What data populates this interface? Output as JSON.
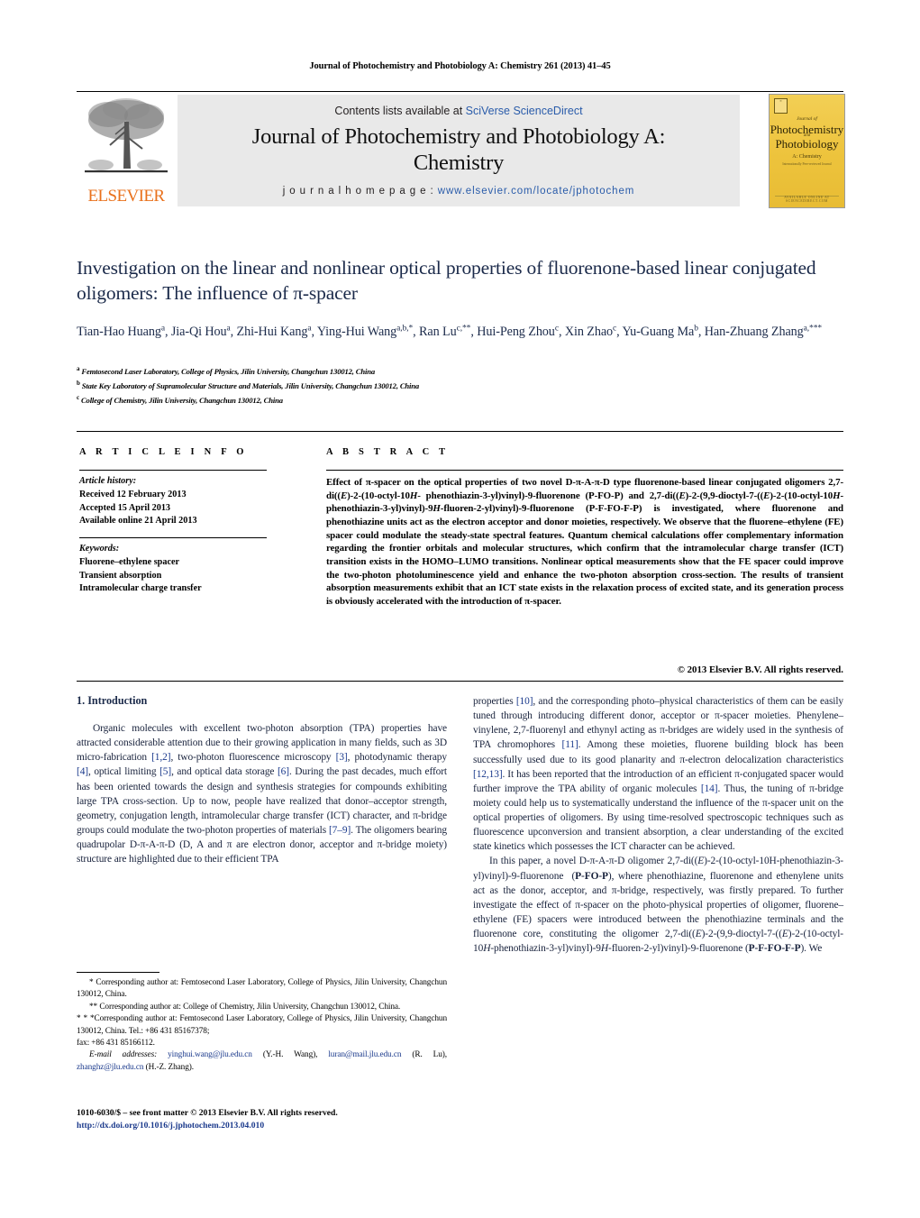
{
  "running_head": "Journal of Photochemistry and Photobiology A: Chemistry 261 (2013) 41–45",
  "masthead": {
    "contents_prefix": "Contents lists available at ",
    "contents_link": "SciVerse ScienceDirect",
    "journal_title_line1": "Journal of Photochemistry and Photobiology A:",
    "journal_title_line2": "Chemistry",
    "homepage_prefix": "j o u r n a l   h o m e p a g e :   ",
    "homepage_url": "www.elsevier.com/locate/jphotochem",
    "publisher_wordmark": "ELSEVIER",
    "cover": {
      "journal_of": "Journal of",
      "title_line1": "Photochemistry",
      "and": "and",
      "title_line2": "Photobiology",
      "subtitle": "A: Chemistry",
      "subtitle2": "Internationally Peer-reviewed Journal",
      "footer": "AVAILABLE ONLINE AT SCIENCEDIRECT.COM"
    }
  },
  "article": {
    "title": "Investigation on the linear and nonlinear optical properties of fluorenone-based linear conjugated oligomers: The influence of π-spacer",
    "authors_html": "Tian-Hao Huang<sup>a</sup>, Jia-Qi Hou<sup>a</sup>, Zhi-Hui Kang<sup>a</sup>, Ying-Hui Wang<sup>a,b,</sup><sup>*</sup>, Ran Lu<sup>c,</sup><sup>**</sup>, Hui-Peng Zhou<sup>c</sup>, Xin Zhao<sup>c</sup>, Yu-Guang Ma<sup>b</sup>, Han-Zhuang Zhang<sup>a,</sup><sup>***</sup>",
    "affiliations": [
      {
        "marker": "a",
        "text": "Femtosecond Laser Laboratory, College of Physics, Jilin University, Changchun 130012, China"
      },
      {
        "marker": "b",
        "text": "State Key Laboratory of Supramolecular Structure and Materials, Jilin University, Changchun 130012, China"
      },
      {
        "marker": "c",
        "text": "College of Chemistry, Jilin University, Changchun 130012, China"
      }
    ]
  },
  "article_info": {
    "heading": "A R T I C L E   I N F O",
    "history_label": "Article history:",
    "history": [
      "Received 12 February 2013",
      "Accepted 15 April 2013",
      "Available online 21 April 2013"
    ],
    "keywords_label": "Keywords:",
    "keywords": [
      "Fluorene–ethylene spacer",
      "Transient absorption",
      "Intramolecular charge transfer"
    ]
  },
  "abstract": {
    "heading": "A B S T R A C T",
    "text_html": "Effect of π-spacer on the optical properties of two novel D-π-A-π-D type fluorenone-based linear conjugated oligomers 2,7-di((<i>E</i>)-2-(10-octyl-10<i>H</i>- phenothiazin-3-yl)vinyl)-9-fluorenone (<b>P-FO-P</b>) and 2,7-di((<i>E</i>)-2-(9,9-dioctyl-7-((<i>E</i>)-2-(10-octyl-10<i>H</i>-phenothiazin-3-yl)vinyl)-9<i>H</i>-fluoren-2-yl)vinyl)-9-fluorenone (<b>P-F-FO-F-P</b>) is investigated, where fluorenone and phenothiazine units act as the electron acceptor and donor moieties, respectively. We observe that the fluorene–ethylene (FE) spacer could modulate the steady-state spectral features. Quantum chemical calculations offer complementary information regarding the frontier orbitals and molecular structures, which confirm that the intramolecular charge transfer (ICT) transition exists in the HOMO–LUMO transitions. Nonlinear optical measurements show that the FE spacer could improve the two-photon photoluminescence yield and enhance the two-photon absorption cross-section. The results of transient absorption measurements exhibit that an ICT state exists in the relaxation process of excited state, and its generation process is obviously accelerated with the introduction of π-spacer.",
    "copyright": "© 2013 Elsevier B.V. All rights reserved."
  },
  "body": {
    "section_heading": "1.  Introduction",
    "left_column_html": "<p data-name=\"intro-paragraph-1\">Organic molecules with excellent two-photon absorption (TPA) properties have attracted considerable attention due to their growing application in many fields, such as 3D micro-fabrication <span class=\"ref\">[1,2]</span>, two-photon fluorescence microscopy <span class=\"ref\">[3]</span>, photodynamic therapy <span class=\"ref\">[4]</span>, optical limiting <span class=\"ref\">[5]</span>, and optical data storage <span class=\"ref\">[6]</span>. During the past decades, much effort has been oriented towards the design and synthesis strategies for compounds exhibiting large TPA cross-section. Up to now, people have realized that donor–acceptor strength, geometry, conjugation length, intramolecular charge transfer (ICT) character, and π-bridge groups could modulate the two-photon properties of materials <span class=\"ref\">[7–9]</span>. The oligomers bearing quadrupolar D-π-A-π-D (D, A and π are electron donor, acceptor and π-bridge moiety) structure are highlighted due to their efficient TPA</p>",
    "right_column_html": "<p class=\"noind\" data-name=\"intro-paragraph-1-cont\">properties <span class=\"ref\">[10]</span>, and the corresponding photo–physical characteristics of them can be easily tuned through introducing different donor, acceptor or π-spacer moieties. Phenylene–vinylene, 2,7-fluorenyl and ethynyl acting as π-bridges are widely used in the synthesis of TPA chromophores <span class=\"ref\">[11]</span>. Among these moieties, fluorene building block has been successfully used due to its good planarity and π-electron delocalization characteristics <span class=\"ref\">[12,13]</span>. It has been reported that the introduction of an efficient π-conjugated spacer would further improve the TPA ability of organic molecules <span class=\"ref\">[14]</span>. Thus, the tuning of π-bridge moiety could help us to systematically understand the influence of the π-spacer unit on the optical properties of oligomers. By using time-resolved spectroscopic techniques such as fluorescence upconversion and transient absorption, a clear understanding of the excited state kinetics which possesses the ICT character can be achieved.</p><p data-name=\"intro-paragraph-2\">In this paper, a novel D-π-A-π-D oligomer 2,7-di((<i>E</i>)-2-(10-octyl-10H-phenothiazin-3-yl)vinyl)-9-fluorenone &nbsp;(<b>P-FO-P</b>), where phenothiazine, fluorenone and ethenylene units act as the donor, acceptor, and π-bridge, respectively, was firstly prepared. To further investigate the effect of π-spacer on the photo-physical properties of oligomer, fluorene–ethylene (FE) spacers were introduced between the phenothiazine terminals and the fluorenone core, constituting the oligomer 2,7-di((<i>E</i>)-2-(9,9-dioctyl-7-((<i>E</i>)-2-(10-octyl-10<i>H</i>-phenothiazin-3-yl)vinyl)-9<i>H</i>-fluoren-2-yl)vinyl)-9-fluorenone (<b>P-F-FO-F-P</b>). We</p>"
  },
  "footnotes": {
    "html": "<p class=\"ind\" data-name=\"footnote-corresponding-1\">* Corresponding author at: Femtosecond Laser Laboratory, College of Physics, Jilin University, Changchun 130012, China.</p><p class=\"ind\" data-name=\"footnote-corresponding-2\">** Corresponding author at: College of Chemistry, Jilin University, Changchun 130012, China.</p><p data-name=\"footnote-corresponding-3\">* * *Corresponding author at: Femtosecond Laser Laboratory, College of Physics, Jilin University, Changchun 130012, China. Tel.: +86 431 85167378;</p><p data-name=\"footnote-fax\">fax: +86 431 85166112.</p><p class=\"ind\" data-name=\"footnote-emails\"><span class=\"fn-ital\">E-mail addresses:</span> <span class=\"email\">yinghui.wang@jlu.edu.cn</span> (Y.-H. Wang), <span class=\"email\">luran@mail.jlu.edu.cn</span> (R. Lu), <span class=\"email\">zhanghz@jlu.edu.cn</span> (H.-Z. Zhang).</p>"
  },
  "imprint": {
    "issn_line": "1010-6030/$ – see front matter © 2013 Elsevier B.V. All rights reserved.",
    "doi": "http://dx.doi.org/10.1016/j.jphotochem.2013.04.010"
  }
}
